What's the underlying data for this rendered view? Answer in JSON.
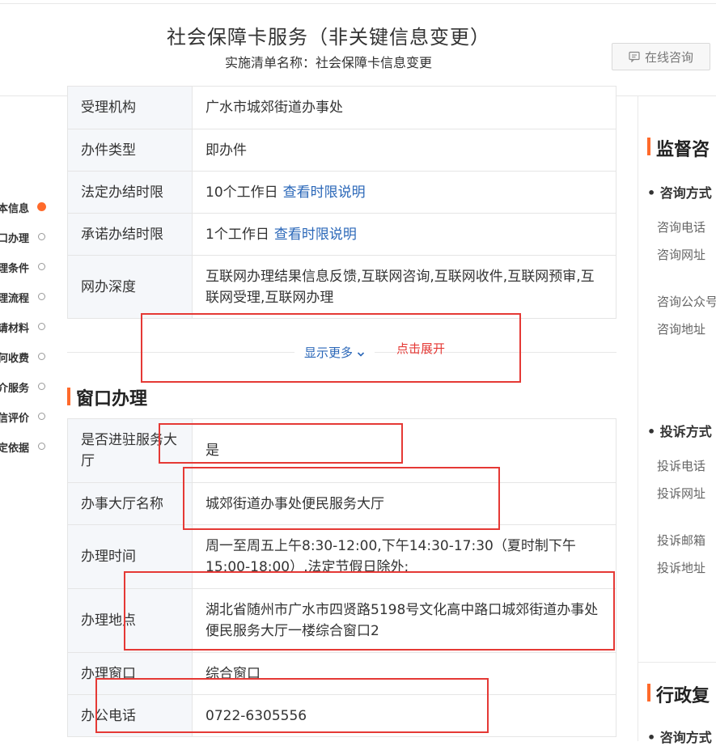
{
  "header": {
    "title": "社会保障卡服务（非关键信息变更）",
    "subtitle": "实施清单名称：社会保障卡信息变更",
    "consult_button": "在线咨询"
  },
  "left_nav": {
    "items": [
      {
        "label": "本信息",
        "active": true
      },
      {
        "label": "口办理",
        "active": false
      },
      {
        "label": "理条件",
        "active": false
      },
      {
        "label": "理流程",
        "active": false
      },
      {
        "label": "请材料",
        "active": false
      },
      {
        "label": "何收费",
        "active": false
      },
      {
        "label": "介服务",
        "active": false
      },
      {
        "label": "信评价",
        "active": false
      },
      {
        "label": "定依据",
        "active": false
      }
    ]
  },
  "basic_info": {
    "rows": [
      {
        "label": "受理机构",
        "value": "广水市城郊街道办事处"
      },
      {
        "label": "办件类型",
        "value": "即办件"
      },
      {
        "label": "法定办结时限",
        "value": "10个工作日",
        "link": "查看时限说明"
      },
      {
        "label": "承诺办结时限",
        "value": "1个工作日",
        "link": "查看时限说明"
      },
      {
        "label": "网办深度",
        "value": "互联网办理结果信息反馈,互联网咨询,互联网收件,互联网预审,互联网受理,互联网办理"
      }
    ],
    "show_more": "显示更多",
    "annotation": "点击展开"
  },
  "window_section": {
    "title": "窗口办理",
    "rows": [
      {
        "label": "是否进驻服务大厅",
        "value": "是"
      },
      {
        "label": "办事大厅名称",
        "value": "城郊街道办事处便民服务大厅"
      },
      {
        "label": "办理时间",
        "value": "周一至周五上午8:30-12:00,下午14:30-17:30（夏时制下午15:00-18:00）,法定节假日除外;"
      },
      {
        "label": "办理地点",
        "value": "湖北省随州市广水市四贤路5198号文化高中路口城郊街道办事处便民服务大厅一楼综合窗口2"
      },
      {
        "label": "办理窗口",
        "value": "综合窗口"
      },
      {
        "label": "办公电话",
        "value": "0722-6305556"
      }
    ]
  },
  "right_panel": {
    "supervise_title": "监督咨",
    "consult_heading": "咨询方式",
    "consult_items": [
      "咨询电话",
      "咨询网址",
      "咨询公众号",
      "咨询地址"
    ],
    "complaint_heading": "投诉方式",
    "complaint_items": [
      "投诉电话",
      "投诉网址",
      "投诉邮箱",
      "投诉地址"
    ],
    "review_title": "行政复",
    "review_consult_heading": "咨询方式"
  },
  "colors": {
    "accent": "#ff6a2b",
    "link": "#2a67b8",
    "annotation_red": "#e53935",
    "label_bg": "#f5f7fa"
  }
}
